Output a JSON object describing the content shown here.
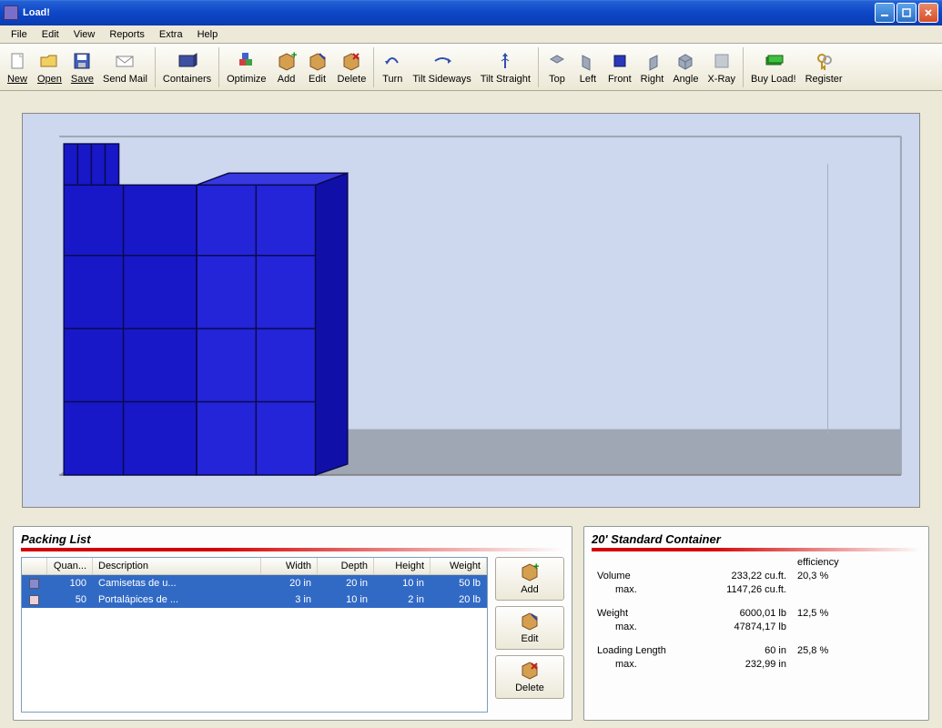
{
  "window": {
    "title": "Load!"
  },
  "menu": [
    "File",
    "Edit",
    "View",
    "Reports",
    "Extra",
    "Help"
  ],
  "toolbar": {
    "new": "New",
    "open": "Open",
    "save": "Save",
    "send_mail": "Send Mail",
    "containers": "Containers",
    "optimize": "Optimize",
    "add": "Add",
    "edit": "Edit",
    "delete": "Delete",
    "turn": "Turn",
    "tilt_sideways": "Tilt Sideways",
    "tilt_straight": "Tilt Straight",
    "top": "Top",
    "left": "Left",
    "front": "Front",
    "right": "Right",
    "angle": "Angle",
    "xray": "X-Ray",
    "buy": "Buy Load!",
    "register": "Register"
  },
  "packing_list": {
    "title": "Packing List",
    "headers": {
      "quantity": "Quan...",
      "description": "Description",
      "width": "Width",
      "depth": "Depth",
      "height": "Height",
      "weight": "Weight"
    },
    "rows": [
      {
        "color": "#8a88d1",
        "quantity": "100",
        "description": "Camisetas de u...",
        "width": "20 in",
        "depth": "20 in",
        "height": "10 in",
        "weight": "50 lb"
      },
      {
        "color": "#eccfd9",
        "quantity": "50",
        "description": "Portalápices de ...",
        "width": "3 in",
        "depth": "10 in",
        "height": "2 in",
        "weight": "20 lb"
      }
    ],
    "buttons": {
      "add": "Add",
      "edit": "Edit",
      "delete": "Delete"
    }
  },
  "container": {
    "title": "20' Standard Container",
    "labels": {
      "efficiency": "efficiency",
      "volume": "Volume",
      "max": "max.",
      "weight": "Weight",
      "loading_length": "Loading Length"
    },
    "volume": {
      "value": "233,22 cu.ft.",
      "max": "1147,26 cu.ft.",
      "efficiency": "20,3 %"
    },
    "weight": {
      "value": "6000,01 lb",
      "max": "47874,17 lb",
      "efficiency": "12,5 %"
    },
    "length": {
      "value": "60 in",
      "max": "232,99 in",
      "efficiency": "25,8 %"
    }
  }
}
